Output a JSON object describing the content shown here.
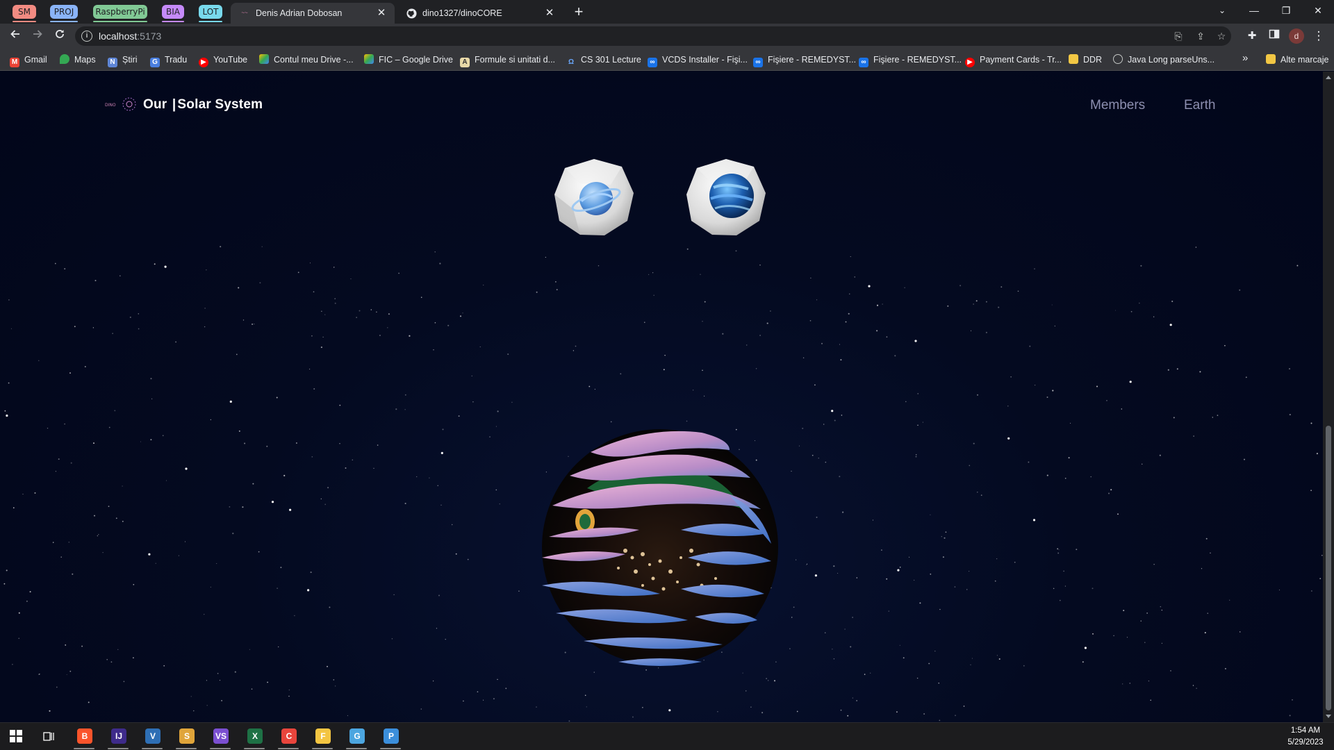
{
  "tab_groups": [
    {
      "label": "SM",
      "color": "#f28b82"
    },
    {
      "label": "PROJ",
      "color": "#8ab4f8"
    },
    {
      "label": "RaspberryPi",
      "color": "#81c995"
    },
    {
      "label": "BIA",
      "color": "#c58af9"
    },
    {
      "label": "LOT",
      "color": "#78d9ec"
    }
  ],
  "tabs": [
    {
      "title": "Denis Adrian Dobosan",
      "active": true
    },
    {
      "title": "dino1327/dinoCORE",
      "active": false
    }
  ],
  "address_bar": {
    "host": "localhost",
    "port": ":5173"
  },
  "bookmarks": [
    {
      "label": "Gmail",
      "icon": "gmail-icon"
    },
    {
      "label": "Maps",
      "icon": "maps-icon"
    },
    {
      "label": "Știri",
      "icon": "news-icon"
    },
    {
      "label": "Tradu",
      "icon": "translate-icon"
    },
    {
      "label": "YouTube",
      "icon": "youtube-icon"
    },
    {
      "label": "Contul meu Drive -...",
      "icon": "drive-icon"
    },
    {
      "label": "FIC – Google Drive",
      "icon": "drive-icon"
    },
    {
      "label": "Formule si unitati d...",
      "icon": "document-icon"
    },
    {
      "label": "CS 301 Lecture",
      "icon": "lecture-icon"
    },
    {
      "label": "VCDS Installer - Fişi...",
      "icon": "cloud-icon"
    },
    {
      "label": "Fişiere - REMEDYST...",
      "icon": "cloud-icon"
    },
    {
      "label": "Fişiere - REMEDYST...",
      "icon": "cloud-icon"
    },
    {
      "label": "Payment Cards - Tr...",
      "icon": "youtube-icon"
    },
    {
      "label": "DDR",
      "icon": "folder-icon"
    },
    {
      "label": "Java Long parseUns...",
      "icon": "globe-icon"
    }
  ],
  "bookmarks_overflow": "»",
  "other_bookmarks": "Alte marcaje",
  "site": {
    "logo_small": "DINO",
    "title_part1": "Our",
    "title_sep": "|",
    "title_part2": "Solar System",
    "nav": [
      "Members",
      "Earth"
    ]
  },
  "planet_buttons": [
    "saturn-planet-button",
    "neptune-planet-button"
  ],
  "taskbar_apps": [
    {
      "name": "brave",
      "color": "#fb542b",
      "glyph": "B"
    },
    {
      "name": "intellij",
      "color": "#3e2b8a",
      "glyph": "IJ"
    },
    {
      "name": "virtualbox",
      "color": "#2e6fb5",
      "glyph": "V"
    },
    {
      "name": "sublime",
      "color": "#e0a53a",
      "glyph": "S"
    },
    {
      "name": "visual-studio",
      "color": "#7b4fd1",
      "glyph": "VS"
    },
    {
      "name": "excel",
      "color": "#1e7145",
      "glyph": "X"
    },
    {
      "name": "chrome",
      "color": "#e8453c",
      "glyph": "C"
    },
    {
      "name": "file-explorer",
      "color": "#f4c542",
      "glyph": "F"
    },
    {
      "name": "git",
      "color": "#4ca6e0",
      "glyph": "G"
    },
    {
      "name": "photos",
      "color": "#3b8edb",
      "glyph": "P"
    }
  ],
  "clock": {
    "time": "1:54 AM",
    "date": "5/29/2023"
  }
}
